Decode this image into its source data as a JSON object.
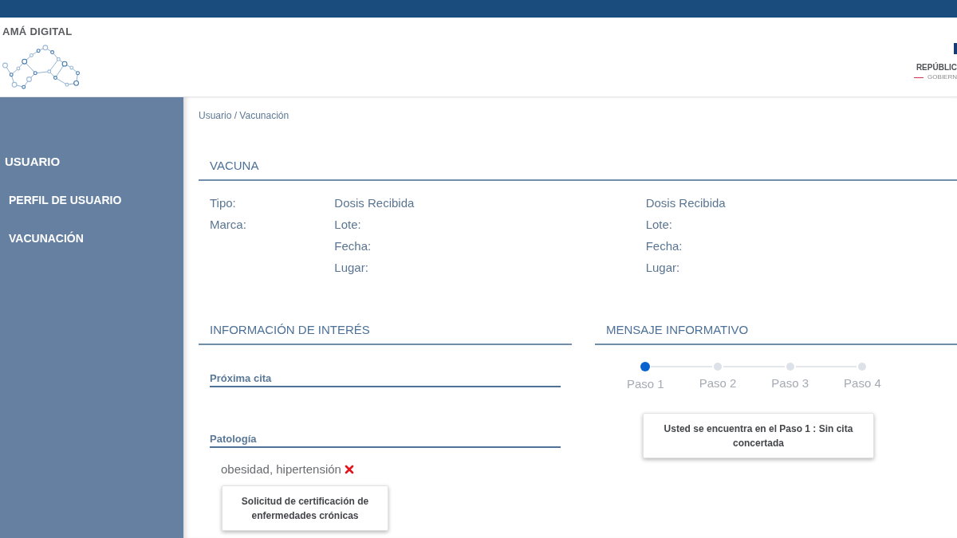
{
  "header": {
    "logo_text": "AMÁ DIGITAL",
    "seal_title": "REPÚBLIC",
    "seal_subtitle": "GOBIERN"
  },
  "sidebar": {
    "heading": "USUARIO",
    "items": [
      {
        "label": "PERFIL DE USUARIO"
      },
      {
        "label": "VACUNACIÓN"
      }
    ]
  },
  "breadcrumb": "Usuario / Vacunación",
  "vacuna": {
    "title": "VACUNA",
    "labels": [
      "Tipo:",
      "Marca:"
    ],
    "doses": [
      {
        "title": "Dosis Recibida",
        "fields": [
          "Lote:",
          "Fecha:",
          "Lugar:"
        ]
      },
      {
        "title": "Dosis Recibida",
        "fields": [
          "Lote:",
          "Fecha:",
          "Lugar:"
        ]
      }
    ]
  },
  "info": {
    "title": "INFORMACIÓN DE INTERÉS",
    "next_appointment": {
      "label": "Próxima cita"
    },
    "pathology": {
      "label": "Patología",
      "value": "obesidad, hipertensión"
    },
    "button": "Solicitud de certificación de enfermedades crónicas"
  },
  "message": {
    "title": "MENSAJE INFORMATIVO",
    "steps": [
      {
        "label": "Paso 1",
        "active": true
      },
      {
        "label": "Paso 2",
        "active": false
      },
      {
        "label": "Paso 3",
        "active": false
      },
      {
        "label": "Paso 4",
        "active": false
      }
    ],
    "text": "Usted se encuentra en el Paso 1 : Sin cita concertada"
  }
}
